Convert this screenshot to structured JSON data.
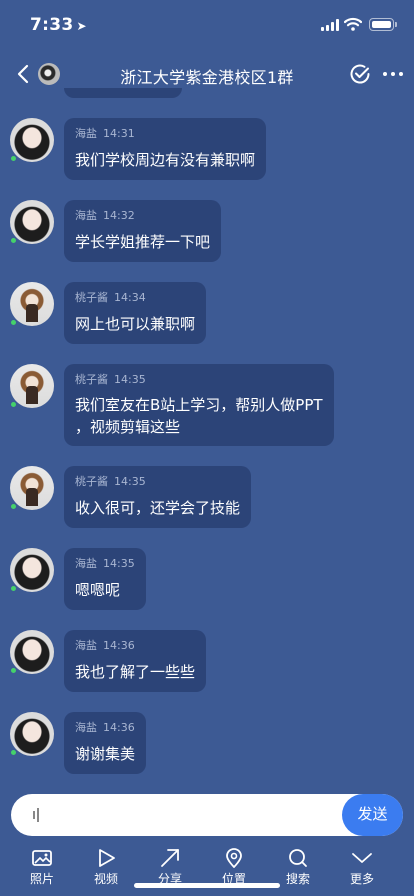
{
  "status_bar": {
    "time": "7:33"
  },
  "nav": {
    "title": "浙江大学紫金港校区1群"
  },
  "messages": [
    {
      "sender": "海盐",
      "time": "14:31",
      "text": "我们学校周边有没有兼职啊",
      "avatar": "girl"
    },
    {
      "sender": "海盐",
      "time": "14:32",
      "text": "学长学姐推荐一下吧",
      "avatar": "girl"
    },
    {
      "sender": "桃子酱",
      "time": "14:34",
      "text": "网上也可以兼职啊",
      "avatar": "peach"
    },
    {
      "sender": "桃子酱",
      "time": "14:35",
      "text_line1": "我们室友在B站上学习，帮别人做PPT",
      "text_line2": "，视频剪辑这些",
      "avatar": "peach"
    },
    {
      "sender": "桃子酱",
      "time": "14:35",
      "text": "收入很可，还学会了技能",
      "avatar": "peach"
    },
    {
      "sender": "海盐",
      "time": "14:35",
      "text": "嗯嗯呢",
      "avatar": "girl"
    },
    {
      "sender": "海盐",
      "time": "14:36",
      "text": "我也了解了一些些",
      "avatar": "girl"
    },
    {
      "sender": "海盐",
      "time": "14:36",
      "text": "谢谢集美",
      "avatar": "girl"
    }
  ],
  "input": {
    "value": "",
    "placeholder": ""
  },
  "send_label": "发送",
  "toolbar": [
    {
      "label": "照片",
      "icon": "photo-icon"
    },
    {
      "label": "视频",
      "icon": "play-icon"
    },
    {
      "label": "分享",
      "icon": "share-arrow-icon"
    },
    {
      "label": "位置",
      "icon": "location-pin-icon"
    },
    {
      "label": "搜索",
      "icon": "search-icon"
    },
    {
      "label": "更多",
      "icon": "chevron-down-icon"
    }
  ],
  "colors": {
    "background": "#3d5a94",
    "bubble": "#2c4478",
    "send_button": "#3b7cf0",
    "online": "#45d16b"
  }
}
